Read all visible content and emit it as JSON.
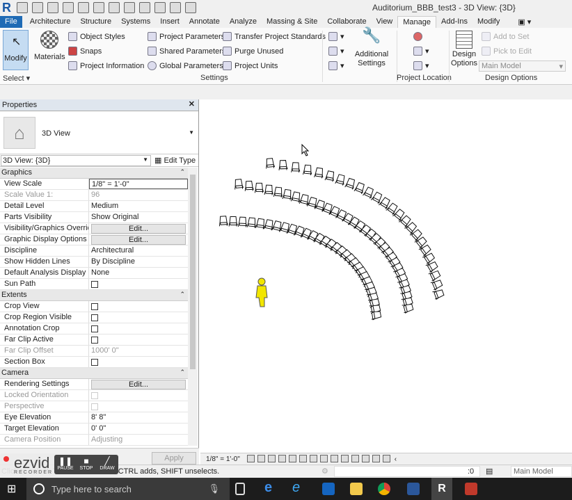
{
  "window": {
    "title": "Auditorium_BBB_test3 - 3D View: {3D}",
    "logo": "R"
  },
  "tabs": [
    "File",
    "Architecture",
    "Structure",
    "Systems",
    "Insert",
    "Annotate",
    "Analyze",
    "Massing & Site",
    "Collaborate",
    "View",
    "Manage",
    "Add-Ins",
    "Modify"
  ],
  "active_tab": "Manage",
  "ribbon": {
    "modify": "Modify",
    "select": "Select",
    "materials": "Materials",
    "object_styles": "Object  Styles",
    "snaps": "Snaps",
    "project_information": "Project  Information",
    "project_parameters": "Project  Parameters",
    "shared_parameters": "Shared  Parameters",
    "global_parameters": "Global  Parameters",
    "transfer_project_standards": "Transfer  Project Standards",
    "purge_unused": "Purge  Unused",
    "project_units": "Project  Units",
    "settings_group": "Settings",
    "additional_settings_1": "Additional",
    "additional_settings_2": "Settings",
    "project_location": "Project Location",
    "design_options_1": "Design",
    "design_options_2": "Options",
    "add_to_set": "Add to Set",
    "pick_to_edit": "Pick to Edit",
    "main_model": "Main Model",
    "design_options_group": "Design Options"
  },
  "properties": {
    "title": "Properties",
    "type_name": "3D View",
    "selector": "3D View: {3D}",
    "edit_type": "Edit Type",
    "sections": [
      {
        "name": "Graphics",
        "rows": [
          {
            "k": "View Scale",
            "v": "1/8\" = 1'-0\"",
            "kind": "input"
          },
          {
            "k": "Scale Value    1:",
            "v": "96",
            "kind": "gray"
          },
          {
            "k": "Detail Level",
            "v": "Medium"
          },
          {
            "k": "Parts Visibility",
            "v": "Show Original"
          },
          {
            "k": "Visibility/Graphics Overrid...",
            "v": "Edit...",
            "kind": "button"
          },
          {
            "k": "Graphic Display Options",
            "v": "Edit...",
            "kind": "button"
          },
          {
            "k": "Discipline",
            "v": "Architectural"
          },
          {
            "k": "Show Hidden Lines",
            "v": "By Discipline"
          },
          {
            "k": "Default Analysis Display S...",
            "v": "None"
          },
          {
            "k": "Sun Path",
            "v": "",
            "kind": "checkbox"
          }
        ]
      },
      {
        "name": "Extents",
        "rows": [
          {
            "k": "Crop View",
            "v": "",
            "kind": "checkbox"
          },
          {
            "k": "Crop Region Visible",
            "v": "",
            "kind": "checkbox"
          },
          {
            "k": "Annotation Crop",
            "v": "",
            "kind": "checkbox"
          },
          {
            "k": "Far Clip Active",
            "v": "",
            "kind": "checkbox"
          },
          {
            "k": "Far Clip Offset",
            "v": "1000'  0\"",
            "kind": "gray"
          },
          {
            "k": "Section Box",
            "v": "",
            "kind": "checkbox"
          }
        ]
      },
      {
        "name": "Camera",
        "rows": [
          {
            "k": "Rendering Settings",
            "v": "Edit...",
            "kind": "button"
          },
          {
            "k": "Locked Orientation",
            "v": "",
            "kind": "graycheck"
          },
          {
            "k": "Perspective",
            "v": "",
            "kind": "graycheck"
          },
          {
            "k": "Eye Elevation",
            "v": "8'  8\""
          },
          {
            "k": "Target Elevation",
            "v": "0'  0\""
          },
          {
            "k": "Camera Position",
            "v": "Adjusting",
            "kind": "gray"
          }
        ]
      }
    ],
    "apply": "Apply"
  },
  "view_bar": {
    "scale": "1/8\" = 1'-0\""
  },
  "status": {
    "text": "Click to select, TAB for alternates, CTRL adds, SHIFT unselects.",
    "workset_count": ":0",
    "model": "Main Model"
  },
  "ezvid": {
    "brand": "ezvid",
    "sub": "RECORDER",
    "pause": "PAUSE",
    "stop": "STOP",
    "draw": "DRAW"
  },
  "taskbar": {
    "search_placeholder": "Type here to search"
  },
  "colors": {
    "accent": "#1f6bb5",
    "figure": "#f2e600"
  }
}
